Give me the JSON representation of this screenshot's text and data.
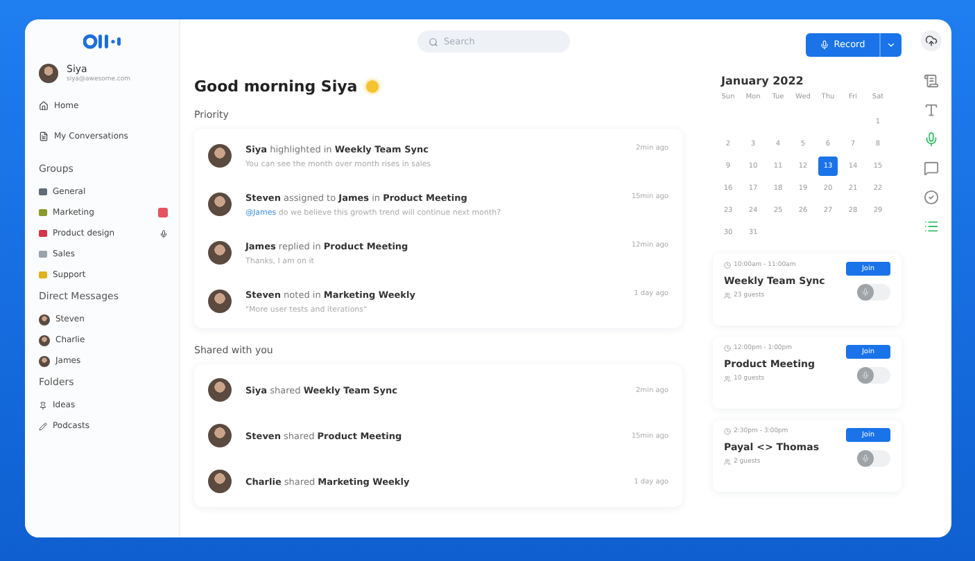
{
  "user": {
    "name": "Siya",
    "email": "siya@awesome.com"
  },
  "nav": [
    {
      "label": "Home",
      "kind": "home"
    },
    {
      "label": "My Conversations",
      "kind": "doc"
    }
  ],
  "groups_title": "Groups",
  "groups": [
    {
      "label": "General",
      "color": "#5f6b7a",
      "kind": "plain"
    },
    {
      "label": "Marketing",
      "color": "#8a9a2a",
      "kind": "alert"
    },
    {
      "label": "Product design",
      "color": "#d6334a",
      "kind": "mic"
    },
    {
      "label": "Sales",
      "color": "#9aa3ad",
      "kind": "plain"
    },
    {
      "label": "Support",
      "color": "#e0b21c",
      "kind": "plain"
    }
  ],
  "dm_title": "Direct Messages",
  "direct_messages": [
    "Steven",
    "Charlie",
    "James"
  ],
  "folders_title": "Folders",
  "folders": [
    {
      "label": "Ideas",
      "kind": "pin"
    },
    {
      "label": "Podcasts",
      "kind": "pen"
    }
  ],
  "search": {
    "placeholder": "Search"
  },
  "greeting": "Good morning Siya",
  "priority_title": "Priority",
  "priority": [
    {
      "title": "**Siya** highlighted in **Weekly Team Sync**",
      "text": "You can see the month over month rises in sales",
      "time": "2min ago"
    },
    {
      "title": "**Steven** assigned to **James** in **Product Meeting**",
      "mention": "@James",
      "text": " do we believe this growth trend will continue next month?",
      "time": "15min ago"
    },
    {
      "title": "**James** replied in **Product Meeting**",
      "text": "Thanks, I am on it",
      "time": "12min ago"
    },
    {
      "title": "**Steven** noted in **Marketing Weekly**",
      "text": "\"More user tests and iterations\"",
      "time": "1 day ago"
    }
  ],
  "shared_title": "Shared with you",
  "shared": [
    {
      "title": "**Siya** shared **Weekly Team Sync**",
      "time": "2min ago"
    },
    {
      "title": "**Steven** shared **Product Meeting**",
      "time": "15min ago"
    },
    {
      "title": "**Charlie** shared **Marketing Weekly**",
      "time": "1 day ago"
    }
  ],
  "record_button": "Record",
  "calendar": {
    "title": "January 2022",
    "weekdays": [
      "Sun",
      "Mon",
      "Tue",
      "Wed",
      "Thu",
      "Fri",
      "Sat"
    ],
    "days": [
      {
        "label": "1",
        "muted": false,
        "selected": false
      },
      {
        "label": "2",
        "muted": false,
        "selected": false
      },
      {
        "label": "3",
        "muted": false,
        "selected": false
      },
      {
        "label": "4",
        "muted": false,
        "selected": false
      },
      {
        "label": "5",
        "muted": false,
        "selected": false
      },
      {
        "label": "6",
        "muted": false,
        "selected": false
      },
      {
        "label": "7",
        "muted": false,
        "selected": false
      },
      {
        "label": "8",
        "muted": false,
        "selected": false
      },
      {
        "label": "9",
        "muted": false,
        "selected": false
      },
      {
        "label": "10",
        "muted": false,
        "selected": false
      },
      {
        "label": "11",
        "muted": false,
        "selected": false
      },
      {
        "label": "12",
        "muted": false,
        "selected": false
      },
      {
        "label": "13",
        "muted": false,
        "selected": true
      },
      {
        "label": "14",
        "muted": false,
        "selected": false
      },
      {
        "label": "15",
        "muted": false,
        "selected": false
      },
      {
        "label": "16",
        "muted": false,
        "selected": false
      },
      {
        "label": "17",
        "muted": false,
        "selected": false
      },
      {
        "label": "18",
        "muted": false,
        "selected": false
      },
      {
        "label": "19",
        "muted": false,
        "selected": false
      },
      {
        "label": "20",
        "muted": false,
        "selected": false
      },
      {
        "label": "21",
        "muted": false,
        "selected": false
      },
      {
        "label": "22",
        "muted": false,
        "selected": false
      },
      {
        "label": "23",
        "muted": false,
        "selected": false
      },
      {
        "label": "24",
        "muted": false,
        "selected": false
      },
      {
        "label": "25",
        "muted": false,
        "selected": false
      },
      {
        "label": "26",
        "muted": false,
        "selected": false
      },
      {
        "label": "27",
        "muted": false,
        "selected": false
      },
      {
        "label": "28",
        "muted": false,
        "selected": false
      },
      {
        "label": "29",
        "muted": false,
        "selected": false
      },
      {
        "label": "30",
        "muted": false,
        "selected": false
      },
      {
        "label": "31",
        "muted": false,
        "selected": false
      }
    ]
  },
  "meetings": [
    {
      "time": "10:00am - 11:00am",
      "title": "Weekly Team Sync",
      "guests": "23 guests",
      "join": "Join",
      "on": false
    },
    {
      "time": "12:00pm - 1:00pm",
      "title": "Product Meeting",
      "guests": "10 guests",
      "join": "Join",
      "on": false
    },
    {
      "time": "2:30pm - 3:00pm",
      "title": "Payal <> Thomas",
      "guests": "2 guests",
      "join": "Join",
      "on": false
    }
  ]
}
